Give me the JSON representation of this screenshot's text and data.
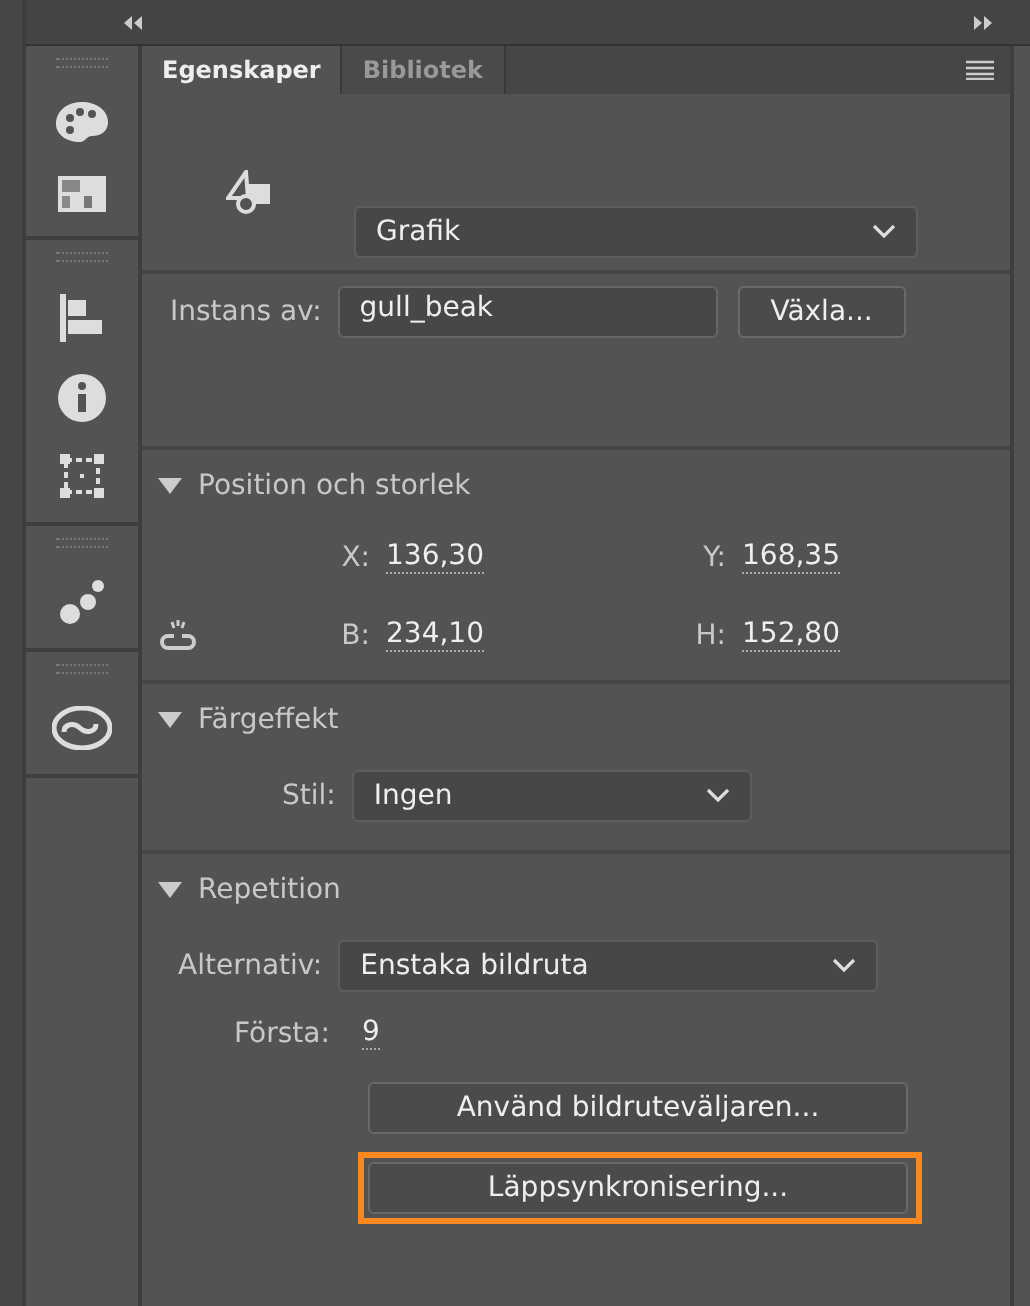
{
  "tabs": [
    {
      "label": "Egenskaper",
      "selected": true
    },
    {
      "label": "Bibliotek",
      "selected": false
    }
  ],
  "symbol": {
    "type": "Grafik",
    "instance_label": "Instans av:",
    "instance": "gull_beak",
    "swap_button": "Växla..."
  },
  "sections": [
    {
      "kind": "position",
      "title": "Position och storlek",
      "expanded": true,
      "rows": [
        {
          "linked": false,
          "a_label": "X:",
          "a_value": "136,30",
          "b_label": "Y:",
          "b_value": "168,35"
        },
        {
          "linked": true,
          "a_label": "B:",
          "a_value": "234,10",
          "b_label": "H:",
          "b_value": "152,80"
        }
      ]
    },
    {
      "kind": "color",
      "title": "Färgeffekt",
      "expanded": true,
      "style_label": "Stil:",
      "style": "Ingen"
    },
    {
      "kind": "looping",
      "title": "Repetition",
      "expanded": true,
      "option_label": "Alternativ:",
      "option": "Enstaka bildruta",
      "first_label": "Första:",
      "first": "9",
      "buttons": [
        {
          "label": "Använd bildruteväljaren...",
          "highlighted": false
        },
        {
          "label": "Läppsynkronisering...",
          "highlighted": true
        }
      ]
    }
  ]
}
